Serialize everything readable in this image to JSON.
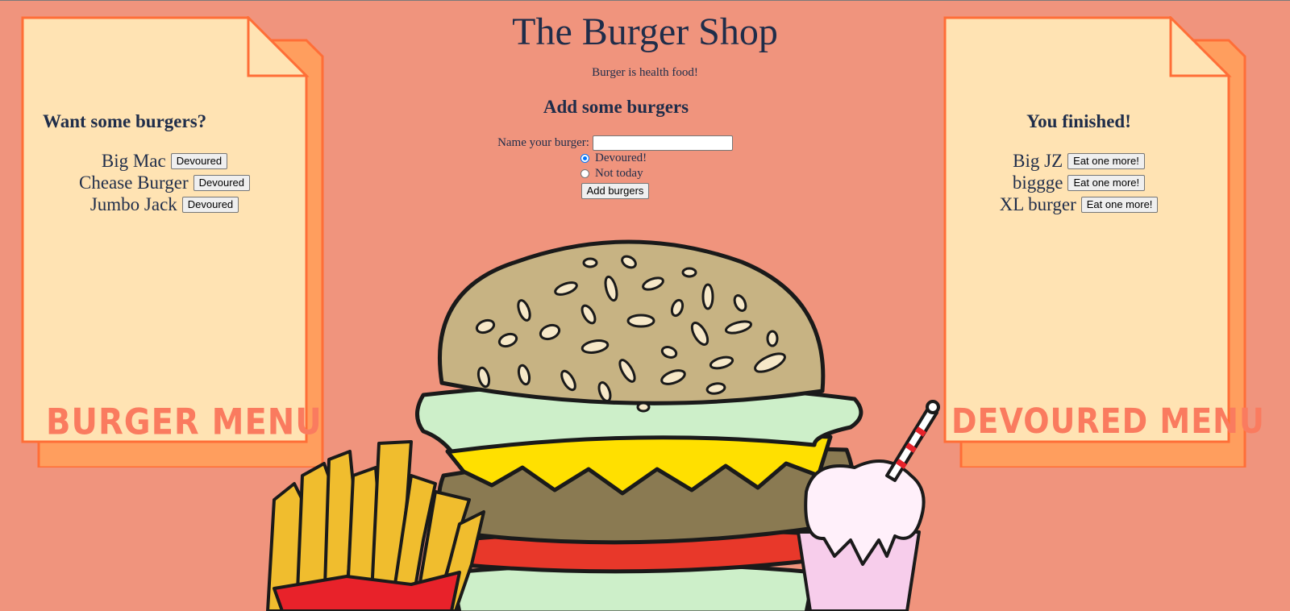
{
  "header": {
    "title": "The Burger Shop",
    "tagline": "Burger is health food!",
    "add_heading": "Add some burgers"
  },
  "form": {
    "name_label": "Name your burger:",
    "name_value": "",
    "radio_devoured": "Devoured!",
    "radio_not_today": "Not today",
    "selected": "Devoured!",
    "submit_label": "Add burgers"
  },
  "menu": {
    "heading": "Want some burgers?",
    "items": [
      {
        "name": "Big Mac",
        "button": "Devoured"
      },
      {
        "name": "Chease Burger",
        "button": "Devoured"
      },
      {
        "name": "Jumbo Jack",
        "button": "Devoured"
      }
    ],
    "label": "BURGER MENU"
  },
  "devoured": {
    "heading": "You finished!",
    "items": [
      {
        "name": "Big JZ",
        "button": "Eat one more!"
      },
      {
        "name": "biggge",
        "button": "Eat one more!"
      },
      {
        "name": "XL burger",
        "button": "Eat one more!"
      }
    ],
    "label": "DEVOURED MENU"
  },
  "colors": {
    "background": "#F0947D",
    "paper": "#FFE3B3",
    "paper_edge": "#FF6E37",
    "accent_text": "#FA7B5F",
    "heading_text": "#1f2d4a"
  }
}
